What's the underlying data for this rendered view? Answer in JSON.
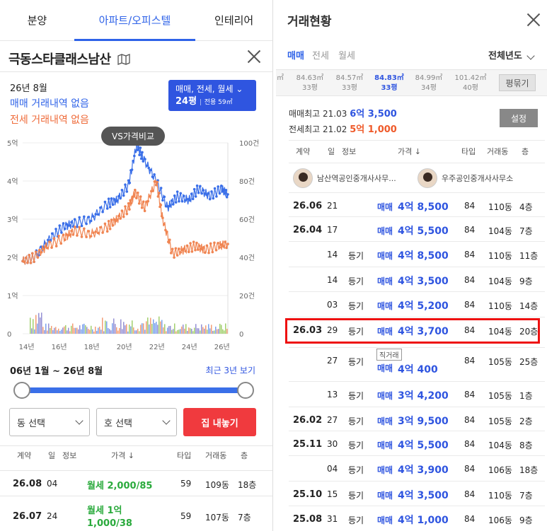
{
  "nav": {
    "tabs": [
      "분양",
      "아파트/오피스텔",
      "인테리어"
    ]
  },
  "complex": {
    "name": "극동스타클래스남산"
  },
  "summary": {
    "date": "26년 8월",
    "sale_status": "매매 거래내역 없음",
    "jeonse_status": "전세 거래내역 없음"
  },
  "type_box": {
    "line1": "매매, 전세, 월세",
    "pyeong": "24평",
    "area": "전용 59㎡"
  },
  "compare_button": "VS가격비교",
  "chart_data": {
    "type": "line",
    "x": [
      "14년",
      "16년",
      "18년",
      "20년",
      "22년",
      "24년",
      "26년"
    ],
    "ylabel_left_ticks": [
      "5억",
      "4억",
      "3억",
      "2억",
      "1억",
      "0"
    ],
    "ylabel_right_ticks": [
      "100건",
      "80건",
      "60건",
      "40건",
      "20건",
      "0"
    ],
    "ylim": [
      0,
      5
    ],
    "series": [
      {
        "name": "매매",
        "color": "#3a6fe8",
        "points": [
          [
            13.8,
            1.9
          ],
          [
            14.5,
            2.0
          ],
          [
            15.5,
            2.5
          ],
          [
            16.3,
            2.8
          ],
          [
            17.0,
            2.9
          ],
          [
            18.0,
            3.0
          ],
          [
            19.0,
            3.4
          ],
          [
            19.6,
            3.5
          ],
          [
            20.3,
            3.9
          ],
          [
            20.8,
            4.95
          ],
          [
            21.2,
            4.6
          ],
          [
            22.0,
            4.0
          ],
          [
            22.7,
            3.3
          ],
          [
            23.3,
            3.6
          ],
          [
            24.0,
            3.5
          ],
          [
            24.6,
            3.8
          ],
          [
            25.3,
            3.6
          ],
          [
            26.0,
            3.8
          ],
          [
            26.4,
            3.65
          ]
        ]
      },
      {
        "name": "전세",
        "color": "#f08552",
        "points": [
          [
            13.8,
            1.9
          ],
          [
            14.5,
            2.0
          ],
          [
            15.3,
            2.3
          ],
          [
            16.3,
            2.5
          ],
          [
            17.0,
            2.7
          ],
          [
            18.0,
            2.6
          ],
          [
            19.0,
            2.8
          ],
          [
            19.6,
            3.0
          ],
          [
            20.3,
            3.3
          ],
          [
            20.7,
            3.7
          ],
          [
            21.3,
            3.3
          ],
          [
            22.0,
            4.0
          ],
          [
            22.4,
            3.0
          ],
          [
            23.0,
            2.1
          ],
          [
            23.7,
            2.2
          ],
          [
            24.4,
            2.3
          ],
          [
            25.0,
            2.2
          ],
          [
            25.8,
            2.3
          ],
          [
            26.4,
            2.35
          ]
        ]
      }
    ]
  },
  "range_label": "06년 1월 ~ 26년 8월",
  "recent_button": "최근 3년 보기",
  "selects": {
    "dong": "동 선택",
    "ho": "호 선택"
  },
  "list_button": "집 내놓기",
  "left_table": {
    "headers": [
      "계약",
      "일",
      "정보",
      "가격 ↓",
      "타입",
      "거래동",
      "층"
    ],
    "rows": [
      {
        "month": "26.08",
        "day": "04",
        "price": "월세 2,000/85",
        "type": "59",
        "dong": "109동",
        "floor": "18층"
      },
      {
        "month": "26.07",
        "day": "24",
        "price1": "월세 1억",
        "price2": "1,000/38",
        "type": "59",
        "dong": "107동",
        "floor": "7층"
      }
    ]
  },
  "panel": {
    "title": "거래현황"
  },
  "deal_tabs": [
    "매매",
    "전세",
    "월세"
  ],
  "year_select": "전체년도",
  "areas": [
    {
      "m2": "84.63㎡",
      "py": "33평"
    },
    {
      "m2": "84.57㎡",
      "py": "33평"
    },
    {
      "m2": "84.83㎡",
      "py": "33평"
    },
    {
      "m2": "84.99㎡",
      "py": "34평"
    },
    {
      "m2": "101.42㎡",
      "py": "40평"
    }
  ],
  "area_unit": "㎡",
  "pyeong_button": "평묶기",
  "max": {
    "sale_label": "매매최고",
    "sale_date": "21.03",
    "sale_price": "6억 3,500",
    "jeonse_label": "전세최고",
    "jeonse_date": "21.02",
    "jeonse_price": "5억 1,000"
  },
  "settings_button": "설정",
  "right_table": {
    "headers": [
      "계약",
      "일",
      "정보",
      "가격 ↓",
      "타입",
      "거래동",
      "층"
    ],
    "agents": [
      "남산역공인중개사사무...",
      "우주공인중개사사무소"
    ],
    "rows": [
      {
        "month": "26.06",
        "day": "21",
        "info": "",
        "kind": "매매",
        "price": "4억 8,500",
        "type": "84",
        "dong": "110동",
        "floor": "4층"
      },
      {
        "month": "26.04",
        "day": "17",
        "info": "",
        "kind": "매매",
        "price": "4억 5,500",
        "type": "84",
        "dong": "104동",
        "floor": "7층"
      },
      {
        "month": "",
        "day": "14",
        "info": "등기",
        "kind": "매매",
        "price": "4억 8,500",
        "type": "84",
        "dong": "110동",
        "floor": "11층"
      },
      {
        "month": "",
        "day": "14",
        "info": "등기",
        "kind": "매매",
        "price": "4억 3,500",
        "type": "84",
        "dong": "104동",
        "floor": "9층"
      },
      {
        "month": "",
        "day": "03",
        "info": "등기",
        "kind": "매매",
        "price": "4억 5,200",
        "type": "84",
        "dong": "110동",
        "floor": "14층"
      },
      {
        "month": "26.03",
        "day": "29",
        "info": "등기",
        "kind": "매매",
        "price": "4억 3,700",
        "type": "84",
        "dong": "104동",
        "floor": "20층"
      },
      {
        "month": "",
        "day": "27",
        "info": "등기",
        "kind": "매매",
        "price": "4억 400",
        "type": "84",
        "dong": "105동",
        "floor": "25층"
      },
      {
        "month": "",
        "day": "13",
        "info": "등기",
        "kind": "매매",
        "price": "3억 4,200",
        "type": "84",
        "dong": "105동",
        "floor": "1층"
      },
      {
        "month": "26.02",
        "day": "27",
        "info": "등기",
        "kind": "매매",
        "price": "3억 9,500",
        "type": "84",
        "dong": "105동",
        "floor": "2층"
      },
      {
        "month": "25.11",
        "day": "30",
        "info": "등기",
        "kind": "매매",
        "price": "4억 5,500",
        "type": "84",
        "dong": "104동",
        "floor": "8층"
      },
      {
        "month": "",
        "day": "04",
        "info": "등기",
        "kind": "매매",
        "price": "4억 3,900",
        "type": "84",
        "dong": "106동",
        "floor": "18층"
      },
      {
        "month": "25.10",
        "day": "15",
        "info": "등기",
        "kind": "매매",
        "price": "4억 3,500",
        "type": "84",
        "dong": "110동",
        "floor": "7층"
      },
      {
        "month": "25.08",
        "day": "31",
        "info": "등기",
        "kind": "매매",
        "price": "4억 1,000",
        "type": "84",
        "dong": "106동",
        "floor": "9층"
      }
    ],
    "direct_badge": "직거래"
  }
}
